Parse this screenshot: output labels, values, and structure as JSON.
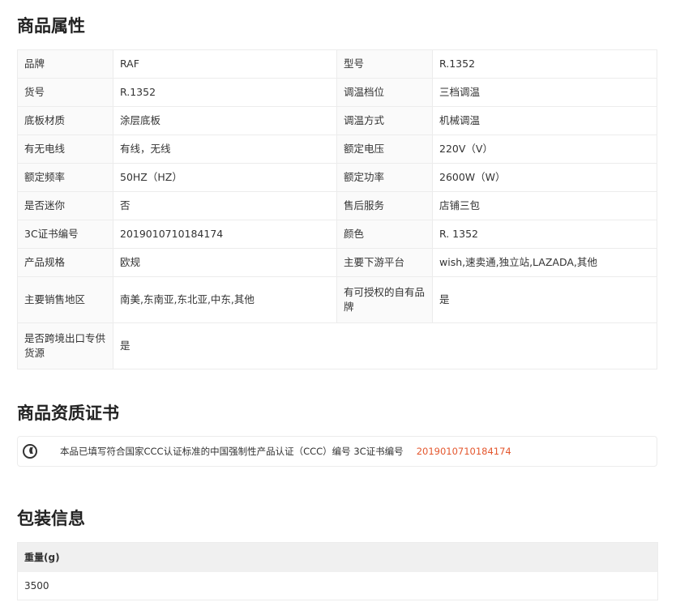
{
  "attributes": {
    "title": "商品属性",
    "rows": [
      [
        "品牌",
        "RAF",
        "型号",
        "R.1352"
      ],
      [
        "货号",
        "R.1352",
        "调温档位",
        "三档调温"
      ],
      [
        "底板材质",
        "涂层底板",
        "调温方式",
        "机械调温"
      ],
      [
        "有无电线",
        "有线，无线",
        "额定电压",
        "220V（V）"
      ],
      [
        "额定频率",
        "50HZ（HZ）",
        "额定功率",
        "2600W（W）"
      ],
      [
        "是否迷你",
        "否",
        "售后服务",
        "店铺三包"
      ],
      [
        "3C证书编号",
        "2019010710184174",
        "颜色",
        "R. 1352"
      ],
      [
        "产品规格",
        "欧规",
        "主要下游平台",
        "wish,速卖通,独立站,LAZADA,其他"
      ],
      [
        "主要销售地区",
        "南美,东南亚,东北亚,中东,其他",
        "有可授权的自有品牌",
        "是"
      ]
    ],
    "last": [
      "是否跨境出口专供货源",
      "是"
    ]
  },
  "cert": {
    "title": "商品资质证书",
    "text": "本品已填写符合国家CCC认证标准的中国强制性产品认证（CCC）编号 3C证书编号",
    "number": "2019010710184174",
    "accent": "#e4572e"
  },
  "packing": {
    "title": "包装信息",
    "header": "重量(g)",
    "value": "3500"
  }
}
